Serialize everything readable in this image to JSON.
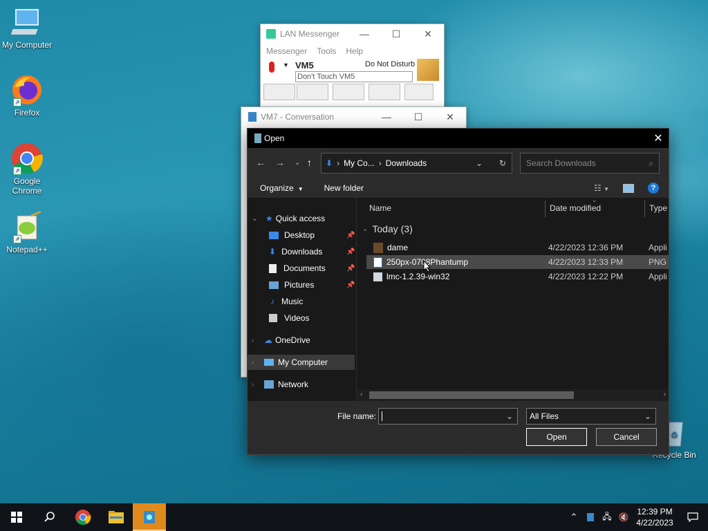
{
  "desktop": {
    "icons": [
      {
        "label": "My Computer"
      },
      {
        "label": "Firefox"
      },
      {
        "label": "Google Chrome"
      },
      {
        "label": "Notepad++"
      },
      {
        "label": "Recycle Bin"
      }
    ]
  },
  "lan_messenger": {
    "title": "LAN Messenger",
    "menu": [
      "Messenger",
      "Tools",
      "Help"
    ],
    "user_name": "VM5",
    "status": "Do Not Disturb",
    "note": "Don't Touch VM5"
  },
  "conversation": {
    "title": "VM7 - Conversation"
  },
  "open_dialog": {
    "title": "Open",
    "breadcrumb": [
      "My Co...",
      "Downloads"
    ],
    "search_placeholder": "Search Downloads",
    "toolbar": {
      "organize": "Organize",
      "new_folder": "New folder"
    },
    "nav": {
      "quick_access": "Quick access",
      "items": [
        "Desktop",
        "Downloads",
        "Documents",
        "Pictures",
        "Music",
        "Videos"
      ],
      "onedrive": "OneDrive",
      "my_computer": "My Computer",
      "network": "Network"
    },
    "columns": {
      "name": "Name",
      "date": "Date modified",
      "type": "Type"
    },
    "group_label": "Today (3)",
    "files": [
      {
        "name": "dame",
        "date": "4/22/2023 12:36 PM",
        "type": "Appli"
      },
      {
        "name": "250px-0708Phantump",
        "date": "4/22/2023 12:33 PM",
        "type": "PNG"
      },
      {
        "name": "lmc-1.2.39-win32",
        "date": "4/22/2023 12:22 PM",
        "type": "Appli"
      }
    ],
    "file_name_label": "File name:",
    "file_name_value": "",
    "filter": "All Files",
    "open_label": "Open",
    "cancel_label": "Cancel"
  },
  "taskbar": {
    "time": "12:39 PM",
    "date": "4/22/2023"
  },
  "colors": {
    "accent": "#0078d7",
    "dialog_bg": "#2b2b2b",
    "taskbar_active": "#e08a1e"
  }
}
